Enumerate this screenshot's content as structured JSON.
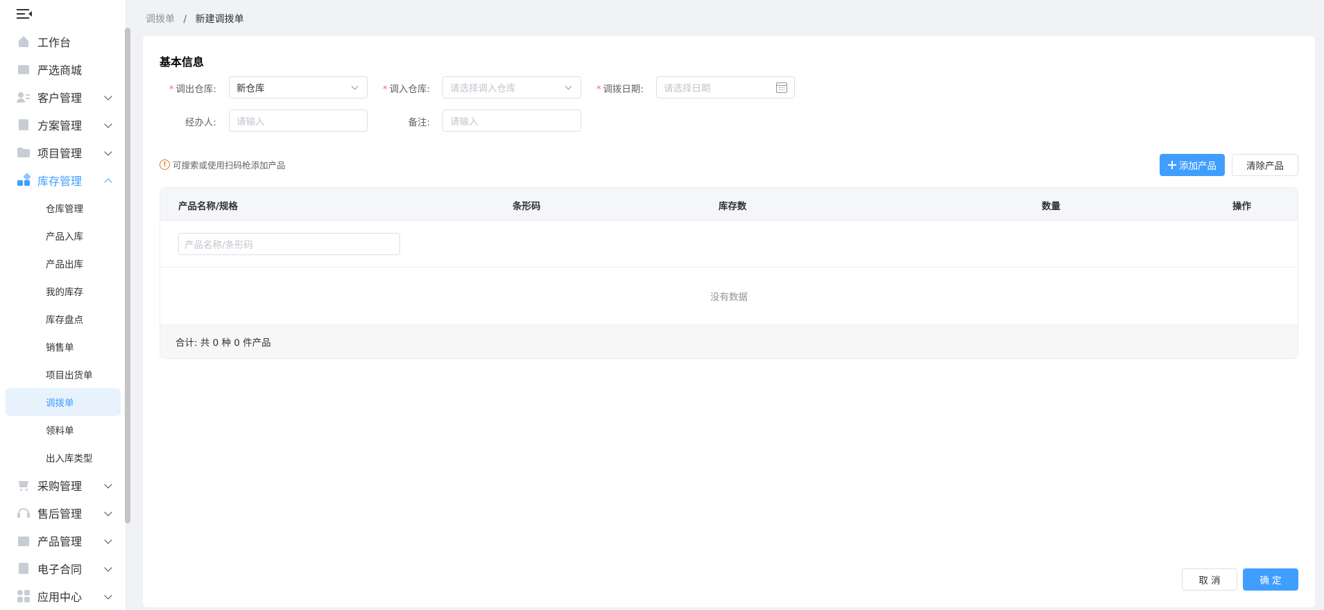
{
  "sidebar": {
    "items": [
      {
        "label": "工作台",
        "icon": "home-icon",
        "expandable": false
      },
      {
        "label": "严选商城",
        "icon": "shop-icon",
        "expandable": false
      },
      {
        "label": "客户管理",
        "icon": "customer-icon",
        "expandable": true
      },
      {
        "label": "方案管理",
        "icon": "plan-icon",
        "expandable": true
      },
      {
        "label": "项目管理",
        "icon": "folder-icon",
        "expandable": true
      },
      {
        "label": "库存管理",
        "icon": "inventory-icon",
        "expandable": true,
        "expanded": true
      },
      {
        "label": "采购管理",
        "icon": "cart-icon",
        "expandable": true
      },
      {
        "label": "售后管理",
        "icon": "headset-icon",
        "expandable": true
      },
      {
        "label": "产品管理",
        "icon": "box-icon",
        "expandable": true
      },
      {
        "label": "电子合同",
        "icon": "contract-icon",
        "expandable": true
      },
      {
        "label": "应用中心",
        "icon": "apps-icon",
        "expandable": true
      }
    ],
    "subitems": [
      "仓库管理",
      "产品入库",
      "产品出库",
      "我的库存",
      "库存盘点",
      "销售单",
      "项目出货单",
      "调拨单",
      "领料单",
      "出入库类型"
    ],
    "active_subitem": "调拨单"
  },
  "breadcrumb": {
    "parent": "调拨单",
    "separator": "/",
    "current": "新建调拨单"
  },
  "form": {
    "section_title": "基本信息",
    "out_warehouse": {
      "label": "调出仓库:",
      "value": "新仓库"
    },
    "in_warehouse": {
      "label": "调入仓库:",
      "placeholder": "请选择调入仓库"
    },
    "transfer_date": {
      "label": "调拨日期:",
      "placeholder": "请选择日期"
    },
    "handler": {
      "label": "经办人:",
      "placeholder": "请输入"
    },
    "remark": {
      "label": "备注:",
      "placeholder": "请输入"
    }
  },
  "tip": {
    "icon_text": "!",
    "text": "可搜索或使用扫码枪添加产品"
  },
  "buttons": {
    "add_product": "添加产品",
    "clear_product": "清除产品",
    "cancel": "取 消",
    "confirm": "确 定"
  },
  "table": {
    "columns": [
      "产品名称/规格",
      "条形码",
      "库存数",
      "数量",
      "操作"
    ],
    "search_placeholder": "产品名称/条形码",
    "empty_text": "没有数据",
    "summary": "合计: 共 0 种 0 件产品"
  },
  "colors": {
    "primary": "#409eff",
    "required": "#f56c6c",
    "warning": "#e6762a"
  }
}
